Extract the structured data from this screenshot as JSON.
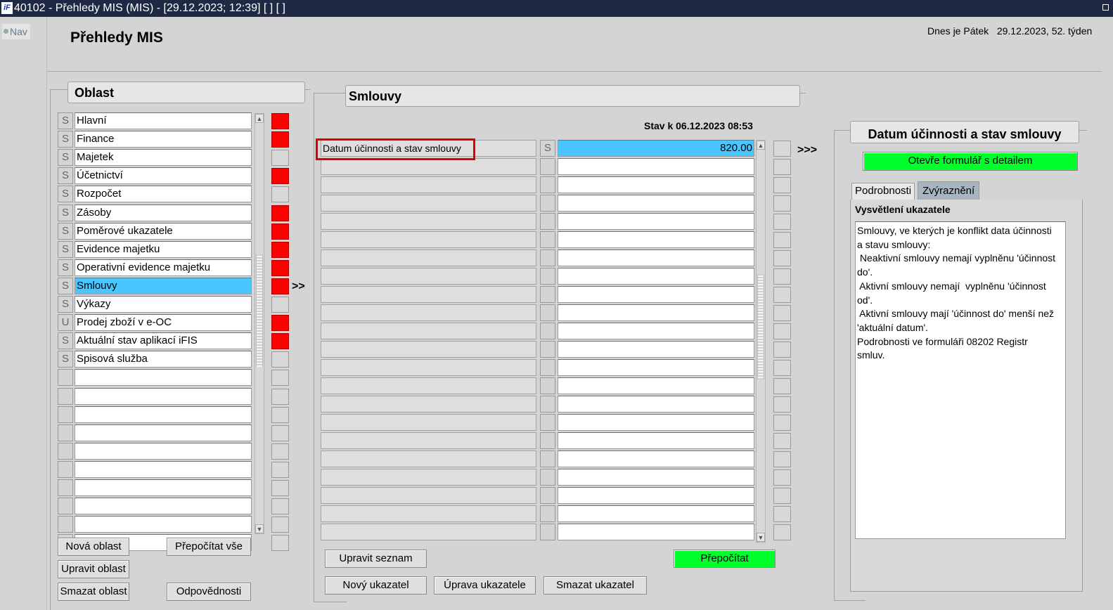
{
  "window": {
    "title": "40102 - Přehledy MIS (MIS) - [29.12.2023; 12:39]  [ ]  [ ]"
  },
  "nav": {
    "label": "Nav"
  },
  "page": {
    "title": "Přehledy MIS",
    "today_prefix": "Dnes je Pátek",
    "today_value": "29.12.2023, 52. týden"
  },
  "oblast": {
    "title": "Oblast",
    "rows": [
      {
        "flag": "S",
        "label": "Hlavní",
        "indicator": "red"
      },
      {
        "flag": "S",
        "label": "Finance",
        "indicator": "red"
      },
      {
        "flag": "S",
        "label": "Majetek",
        "indicator": "none"
      },
      {
        "flag": "S",
        "label": "Účetnictví",
        "indicator": "red"
      },
      {
        "flag": "S",
        "label": "Rozpočet",
        "indicator": "none"
      },
      {
        "flag": "S",
        "label": "Zásoby",
        "indicator": "red"
      },
      {
        "flag": "S",
        "label": "Poměrové ukazatele",
        "indicator": "red"
      },
      {
        "flag": "S",
        "label": "Evidence majetku",
        "indicator": "red"
      },
      {
        "flag": "S",
        "label": "Operativní evidence majetku",
        "indicator": "red"
      },
      {
        "flag": "S",
        "label": "Smlouvy",
        "indicator": "red",
        "selected": true
      },
      {
        "flag": "S",
        "label": "Výkazy",
        "indicator": "none"
      },
      {
        "flag": "U",
        "label": "Prodej zboží v e-OC",
        "indicator": "red"
      },
      {
        "flag": "S",
        "label": "Aktuální stav aplikací iFIS",
        "indicator": "red"
      },
      {
        "flag": "S",
        "label": "Spisová služba",
        "indicator": "none"
      },
      {
        "flag": "",
        "label": "",
        "indicator": "none"
      },
      {
        "flag": "",
        "label": "",
        "indicator": "none"
      },
      {
        "flag": "",
        "label": "",
        "indicator": "none"
      },
      {
        "flag": "",
        "label": "",
        "indicator": "none"
      },
      {
        "flag": "",
        "label": "",
        "indicator": "none"
      },
      {
        "flag": "",
        "label": "",
        "indicator": "none"
      },
      {
        "flag": "",
        "label": "",
        "indicator": "none"
      },
      {
        "flag": "",
        "label": "",
        "indicator": "none"
      },
      {
        "flag": "",
        "label": "",
        "indicator": "none"
      },
      {
        "flag": "",
        "label": "",
        "indicator": "none"
      }
    ],
    "goto_label": ">>",
    "buttons": {
      "new": "Nová oblast",
      "recalc_all": "Přepočítat vše",
      "edit": "Upravit oblast",
      "delete": "Smazat oblast",
      "responsibilities": "Odpovědnosti"
    }
  },
  "smlouvy": {
    "title": "Smlouvy",
    "status": "Stav k 06.12.2023 08:53",
    "rows": [
      {
        "label": "Datum účinnosti a stav smlouvy",
        "flag": "S",
        "value": "820.00",
        "selected": true
      },
      {
        "label": "",
        "flag": "",
        "value": ""
      },
      {
        "label": "",
        "flag": "",
        "value": ""
      },
      {
        "label": "",
        "flag": "",
        "value": ""
      },
      {
        "label": "",
        "flag": "",
        "value": ""
      },
      {
        "label": "",
        "flag": "",
        "value": ""
      },
      {
        "label": "",
        "flag": "",
        "value": ""
      },
      {
        "label": "",
        "flag": "",
        "value": ""
      },
      {
        "label": "",
        "flag": "",
        "value": ""
      },
      {
        "label": "",
        "flag": "",
        "value": ""
      },
      {
        "label": "",
        "flag": "",
        "value": ""
      },
      {
        "label": "",
        "flag": "",
        "value": ""
      },
      {
        "label": "",
        "flag": "",
        "value": ""
      },
      {
        "label": "",
        "flag": "",
        "value": ""
      },
      {
        "label": "",
        "flag": "",
        "value": ""
      },
      {
        "label": "",
        "flag": "",
        "value": ""
      },
      {
        "label": "",
        "flag": "",
        "value": ""
      },
      {
        "label": "",
        "flag": "",
        "value": ""
      },
      {
        "label": "",
        "flag": "",
        "value": ""
      },
      {
        "label": "",
        "flag": "",
        "value": ""
      },
      {
        "label": "",
        "flag": "",
        "value": ""
      },
      {
        "label": "",
        "flag": "",
        "value": ""
      }
    ],
    "goto_label": ">>>",
    "highlight_color": "#e00000",
    "buttons": {
      "edit_list": "Upravit seznam",
      "recalc": "Přepočítat",
      "new_indicator": "Nový ukazatel",
      "edit_indicator": "Úprava ukazatele",
      "delete_indicator": "Smazat ukazatel"
    }
  },
  "detail": {
    "title": "Datum účinnosti a stav smlouvy",
    "open_form": "Otevře formulář s detailem",
    "tabs": [
      "Podrobnosti",
      "Zvýraznění"
    ],
    "section_label": "Vysvětlení ukazatele",
    "explanation_lines": [
      "Smlouvy, ve kterých je konflikt data účinnosti",
      "a stavu smlouvy:",
      " Neaktivní smlouvy nemají vyplněnu 'účinnost",
      "do'.",
      " Aktivní smlouvy nemají  vyplněnu 'účinnost",
      "od'.",
      " Aktivní smlouvy mají 'účinnost do' menší než",
      "'aktuální datum'.",
      "Podrobnosti ve formuláři 08202 Registr",
      "smluv."
    ]
  },
  "colors": {
    "red_indicator": "#ff0000",
    "selected": "#49c5ff",
    "green_button": "#00ff2b"
  }
}
